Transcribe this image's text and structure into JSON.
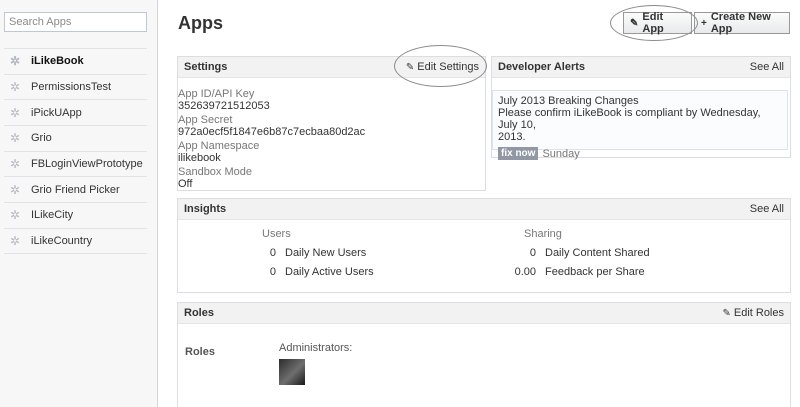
{
  "sidebar": {
    "search_placeholder": "Search Apps",
    "apps": [
      {
        "label": "iLikeBook",
        "active": true
      },
      {
        "label": "PermissionsTest",
        "active": false
      },
      {
        "label": "iPickUApp",
        "active": false
      },
      {
        "label": "Grio",
        "active": false
      },
      {
        "label": "FBLoginViewPrototype",
        "active": false
      },
      {
        "label": "Grio Friend Picker",
        "active": false
      },
      {
        "label": "ILikeCity",
        "active": false
      },
      {
        "label": "iLikeCountry",
        "active": false
      }
    ],
    "app_icon": "gear-icon"
  },
  "header": {
    "title": "Apps",
    "edit_app_label": "Edit App",
    "create_app_label": "Create New App"
  },
  "settings": {
    "title": "Settings",
    "edit_link": "Edit Settings",
    "fields": [
      {
        "label": "App ID/API Key",
        "value": "352639721512053"
      },
      {
        "label": "App Secret",
        "value": "972a0ecf5f1847e6b87c7ecbaa80d2ac"
      },
      {
        "label": "App Namespace",
        "value": "ilikebook"
      },
      {
        "label": "Sandbox Mode",
        "value": "Off"
      }
    ]
  },
  "alerts": {
    "title": "Developer Alerts",
    "see_all": "See All",
    "alert_title": "July 2013 Breaking Changes",
    "alert_text_1": "Please confirm iLikeBook is compliant by Wednesday, July 10,",
    "alert_text_2": "2013.",
    "fix_label": "fix now",
    "date": "Sunday"
  },
  "insights": {
    "title": "Insights",
    "see_all": "See All",
    "users_heading": "Users",
    "sharing_heading": "Sharing",
    "users_rows": [
      {
        "value": "0",
        "label": "Daily New Users"
      },
      {
        "value": "0",
        "label": "Daily Active Users"
      }
    ],
    "sharing_rows": [
      {
        "value": "0",
        "label": "Daily Content Shared"
      },
      {
        "value": "0.00",
        "label": "Feedback per Share"
      }
    ]
  },
  "roles": {
    "title": "Roles",
    "edit_link": "Edit Roles",
    "section_label": "Roles",
    "admins_label": "Administrators:"
  },
  "colors": {
    "sidebar_bg": "#f7f7f7",
    "panel_header_bg": "#f2f2f2",
    "badge_bg": "#9197a3"
  }
}
